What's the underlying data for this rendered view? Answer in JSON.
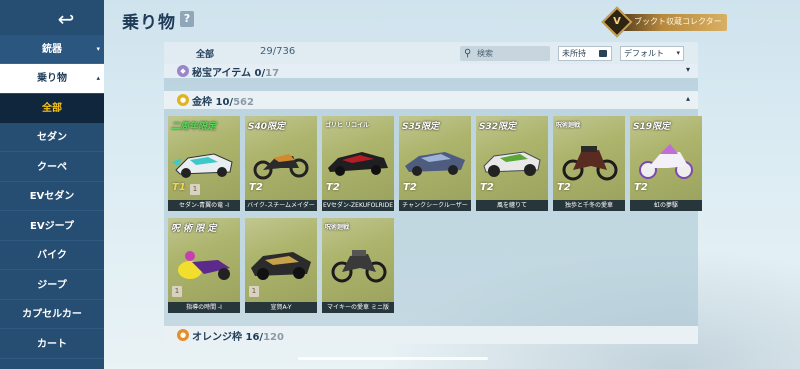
{
  "header": {
    "title": "乗り物",
    "help_label": "?",
    "collector_badge": "ブックト収蔵コレクター",
    "collector_badge_icon": "V"
  },
  "sidebar": {
    "back_icon": "↩",
    "sections": [
      {
        "label": "銃器",
        "caret": "▾"
      }
    ],
    "parent": {
      "label": "乗り物",
      "caret": "▴"
    },
    "items": [
      {
        "label": "全部",
        "active": true
      },
      {
        "label": "セダン"
      },
      {
        "label": "クーペ"
      },
      {
        "label": "EVセダン"
      },
      {
        "label": "EVジープ"
      },
      {
        "label": "バイク"
      },
      {
        "label": "ジープ"
      },
      {
        "label": "カプセルカー"
      },
      {
        "label": "カート"
      }
    ]
  },
  "filterbar": {
    "all_label": "全部",
    "count": "29/736",
    "search_icon": "search-icon",
    "search_placeholder": "検索",
    "unowned_label": "未所持",
    "sort_label": "デフォルト",
    "sort_caret": "▾"
  },
  "categories": [
    {
      "name": "秘宝アイテム",
      "owned": "0",
      "total": "17",
      "caret": "▾"
    },
    {
      "name": "金枠",
      "owned": "10",
      "total": "562",
      "caret": "▴"
    },
    {
      "name": "オレンジ枠",
      "owned": "16",
      "total": "120"
    }
  ],
  "vehicles": [
    {
      "tag": "二周年限定",
      "tier": "T1",
      "tier_gold": true,
      "rank": "1",
      "caption": "セダン-青翼の竜 -I",
      "accent": "#3ec9c9"
    },
    {
      "tag": "S40限定",
      "tier": "T2",
      "caption": "バイク-スチームメイダー",
      "accent": "#d18a2e"
    },
    {
      "tag": "ゴリヒ リコイル",
      "tier": "T2",
      "caption": "EVセダン-ZEKUFOLRIDE",
      "accent": "#b21d26"
    },
    {
      "tag": "S35限定",
      "tier": "T2",
      "caption": "チャンクシークルーザー",
      "accent": "#4e5c80"
    },
    {
      "tag": "S32限定",
      "tier": "T2",
      "caption": "風を纏りて",
      "accent": "#e8e8e8"
    },
    {
      "tag": "呪術廻戦",
      "tier": "T2",
      "caption": "独歩と千冬の愛車",
      "accent": "#5a2b20"
    },
    {
      "tag": "S19限定",
      "tier": "T2",
      "caption": "虹の夢駆",
      "accent": "#c06dd9"
    },
    {
      "tag": "呪 術 限 定",
      "tier": "",
      "rank": "1",
      "caption": "指導の時間 -I",
      "accent": "#f2de2c"
    },
    {
      "tag": "",
      "tier": "",
      "rank": "1",
      "caption": "宣賀A-Y",
      "accent": "#2b2b2b"
    },
    {
      "tag": "呪術廻戦",
      "tier": "",
      "caption": "マイキーの愛車 ミニ版",
      "accent": "#3a3a3a"
    }
  ],
  "colors": {
    "sidebar_bg": "#264e73",
    "active_text": "#f6c21c",
    "card_bg": "#adb46c"
  }
}
